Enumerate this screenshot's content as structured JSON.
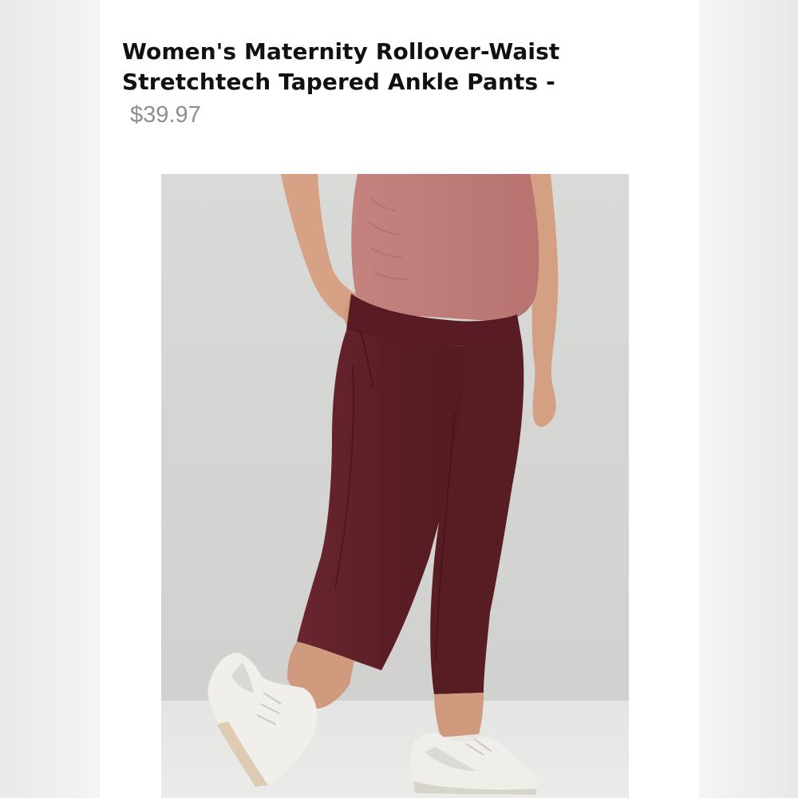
{
  "product": {
    "title_line1": "Women's Maternity Rollover-Waist",
    "title_line2": "Stretchtech Tapered Ankle Pants -",
    "price": "$39.97"
  },
  "colors": {
    "pants": "#5e1f26",
    "top": "#bf7c7a",
    "backdrop": "#d8d9d7",
    "price_text": "#8b8e93"
  }
}
